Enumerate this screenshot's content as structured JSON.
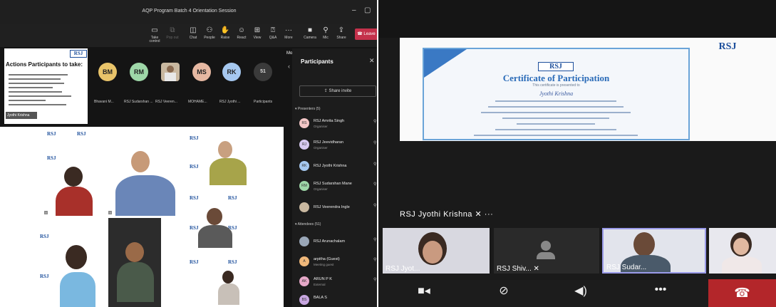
{
  "left_window": {
    "title": "AQP Program Batch 4 Orientation Session",
    "toolbar": [
      {
        "label": "Take control",
        "icon": "take-control-icon"
      },
      {
        "label": "Pop out",
        "icon": "pop-out-icon"
      },
      {
        "label": "Chat",
        "icon": "chat-icon"
      },
      {
        "label": "People",
        "icon": "people-icon"
      },
      {
        "label": "Raise",
        "icon": "raise-hand-icon"
      },
      {
        "label": "React",
        "icon": "react-icon"
      },
      {
        "label": "View",
        "icon": "view-icon"
      },
      {
        "label": "Q&A",
        "icon": "qa-icon"
      },
      {
        "label": "More",
        "icon": "more-icon"
      },
      {
        "label": "Camera",
        "icon": "camera-icon"
      },
      {
        "label": "Mic",
        "icon": "mic-icon"
      },
      {
        "label": "Share",
        "icon": "share-icon"
      }
    ],
    "leave_label": "Leave",
    "more_actions": "More actions",
    "shared_content": {
      "heading": "Actions Participants to take:",
      "presenter_name": "Jyothi Krishna"
    },
    "avatars": [
      {
        "initials": "BM",
        "name": "Bhavani M...",
        "color": "#e9c46a"
      },
      {
        "initials": "RM",
        "name": "RSJ Sudarshan ...",
        "color": "#9ed7a8"
      },
      {
        "initials": "",
        "name": "RSJ Veeren...",
        "color": "#c9b8a0"
      },
      {
        "initials": "MS",
        "name": "MOHAME...",
        "color": "#e6b8a2"
      },
      {
        "initials": "RK",
        "name": "RSJ Jyothi ...",
        "color": "#a6c8f0"
      },
      {
        "initials": "51",
        "name": "Participants",
        "color": "#3a3a3a"
      }
    ],
    "panel": {
      "title": "Participants",
      "share_invite": "Share invite",
      "presenters_header": "Presenters (5)",
      "presenters": [
        {
          "initials": "RS",
          "name": "RSJ Amrita Singh",
          "role": "Organiser",
          "color": "#f3c6c6"
        },
        {
          "initials": "RJ",
          "name": "RSJ Jeevidharan",
          "role": "Organiser",
          "color": "#d6c9f0"
        },
        {
          "initials": "RK",
          "name": "RSJ Jyothi Krishna",
          "role": "",
          "color": "#a6c8f0"
        },
        {
          "initials": "RM",
          "name": "RSJ Sudarshan Mane",
          "role": "Organiser",
          "color": "#9ed7a8"
        },
        {
          "initials": "",
          "name": "RSJ Veerendra Ingle",
          "role": "",
          "color": "#c9b8a0"
        }
      ],
      "attendees_header": "Attendees (51)",
      "attendees": [
        {
          "initials": "",
          "name": "RSJ Arunachalam",
          "role": "",
          "color": "#9aa7b8"
        },
        {
          "initials": "A",
          "name": "arpitha (Guest)",
          "role": "Meeting guest",
          "color": "#f0b87a"
        },
        {
          "initials": "AK",
          "name": "ARUN P K",
          "role": "External",
          "color": "#e6a8c8"
        },
        {
          "initials": "BS",
          "name": "BALA S",
          "role": "",
          "color": "#c7a6e0"
        }
      ]
    },
    "rsj_logo": "RSJ"
  },
  "right_window": {
    "certificate": {
      "title": "Certificate of Participation",
      "subtitle": "This certificate is presented to",
      "name": "Jyothi Krishna",
      "logo": "RSJ"
    },
    "active_speaker": "RSJ Jyothi Krishna",
    "tiles": [
      {
        "label": "RSJ Jyot...",
        "kind": "video"
      },
      {
        "label": "RSJ Shiv...",
        "kind": "avatar"
      },
      {
        "label": "RSJ Sudar...",
        "kind": "video"
      },
      {
        "label": "",
        "kind": "video"
      }
    ],
    "controls": [
      "camera-icon",
      "mic-off-icon",
      "speaker-icon",
      "more-icon",
      "hang-up-icon"
    ]
  }
}
